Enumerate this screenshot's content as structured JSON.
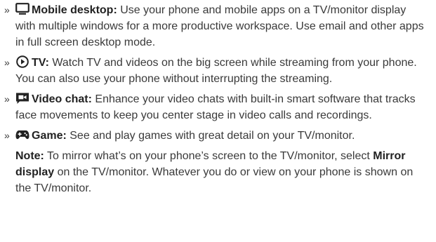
{
  "items": [
    {
      "marker": "»",
      "icon": "monitor-icon",
      "title": "Mobile desktop:",
      "text": " Use your phone and mobile apps on a TV/monitor display with multiple windows for a more productive workspace. Use email and other apps in full screen desktop mode."
    },
    {
      "marker": "»",
      "icon": "play-circle-icon",
      "title": "TV:",
      "text": " Watch TV and videos on the big screen while streaming from your phone. You can also use your phone without interrupting the streaming."
    },
    {
      "marker": "»",
      "icon": "video-chat-icon",
      "title": "Video chat:",
      "text": " Enhance your video chats with built-in smart software that tracks face movements to keep you center stage in video calls and recordings."
    },
    {
      "marker": "»",
      "icon": "gamepad-icon",
      "title": "Game:",
      "text": " See and play games with great detail on your TV/monitor."
    }
  ],
  "note": {
    "label": "Note:",
    "text_before": " To mirror what’s on your phone’s screen to the TV/monitor, select ",
    "emphasis": "Mirror display",
    "text_after": " on the TV/monitor. Whatever you do or view on your phone is shown on the TV/monitor."
  },
  "colors": {
    "text": "#3a3a3a",
    "bold": "#222222"
  }
}
